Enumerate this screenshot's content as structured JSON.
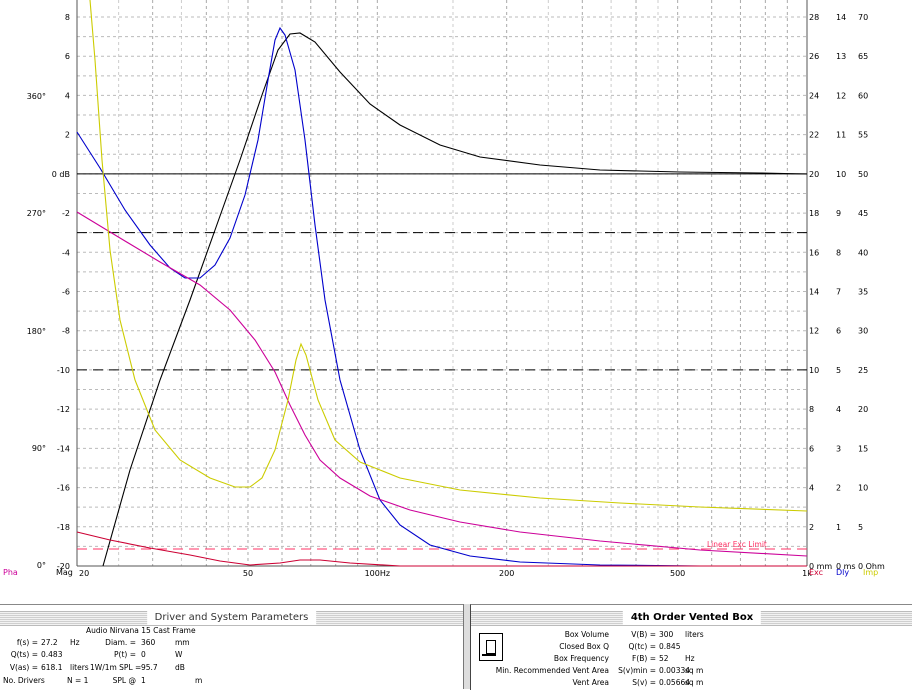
{
  "plot": {
    "left_axis_ticks": [
      "8",
      "6",
      "4",
      "2",
      "0 dB",
      "-2",
      "-4",
      "-6",
      "-8",
      "-10",
      "-12",
      "-14",
      "-16",
      "-18",
      "-20"
    ],
    "phase_labels": [
      "360°",
      "270°",
      "180°",
      "90°",
      "0°"
    ],
    "right_axis1": [
      "28",
      "26",
      "24",
      "22",
      "20",
      "18",
      "16",
      "14",
      "12",
      "10",
      "8",
      "6",
      "4",
      "2",
      "0 mm"
    ],
    "right_axis2": [
      "14",
      "13",
      "12",
      "11",
      "10",
      "9",
      "8",
      "7",
      "6",
      "5",
      "4",
      "3",
      "2",
      "1",
      "0 ms"
    ],
    "right_axis3": [
      "70",
      "65",
      "60",
      "55",
      "50",
      "45",
      "40",
      "35",
      "30",
      "25",
      "20",
      "15",
      "10",
      "5",
      "0 Ohm"
    ],
    "freq_labels": [
      "20",
      "50",
      "100Hz",
      "200",
      "500",
      "1k"
    ],
    "bottom_left_labels": {
      "pha": "Pha",
      "mag": "Mag"
    },
    "bottom_right_labels": {
      "exc": "Exc",
      "dly": "Dly",
      "imp": "Imp"
    },
    "annotation": "Linear Exc Limit",
    "colors": {
      "magnitude": "#000000",
      "excursion": "#0000cc",
      "phase": "#cc0099",
      "delay": "#cc0033",
      "impedance": "#cccc00",
      "limit": "#ff3366",
      "pha_label": "#cc0099",
      "exc_label": "#cc0033",
      "dly_label": "#0000cc",
      "imp_label": "#cccc00"
    }
  },
  "left_panel": {
    "title": "Driver and System Parameters",
    "driver_name": "Audio Nirvana 15 Cast Frame",
    "fs_label": "f(s) =",
    "fs_value": "27.2",
    "fs_unit": "Hz",
    "qts_label": "Q(ts) =",
    "qts_value": "0.483",
    "vas_label": "V(as) =",
    "vas_value": "618.1",
    "vas_unit": "liters",
    "drivers_label": "No. Drivers",
    "drivers_value": "N = 1",
    "diam_label": "Diam. =",
    "diam_value": "360",
    "diam_unit": "mm",
    "pt_label": "P(t) =",
    "pt_value": "0",
    "pt_unit": "W",
    "spl_label": "1W/1m SPL =",
    "spl_value": "95.7",
    "spl_unit": "dB",
    "splat_label": "SPL @",
    "splat_value": "1",
    "splat_unit": "m"
  },
  "right_panel": {
    "title": "4th Order Vented Box",
    "rows": [
      {
        "label": "Box Volume",
        "sym": "V(B) =",
        "value": "300",
        "unit": "liters"
      },
      {
        "label": "Closed Box Q",
        "sym": "Q(tc) =",
        "value": "0.845",
        "unit": ""
      },
      {
        "label": "Box Frequency",
        "sym": "F(B) =",
        "value": "52",
        "unit": "Hz"
      },
      {
        "label": "Min. Recommended Vent Area",
        "sym": "S(v)min =",
        "value": "0.00334",
        "unit": "sq m"
      },
      {
        "label": "Vent Area",
        "sym": "S(v) =",
        "value": "0.05664",
        "unit": "sq m"
      }
    ]
  }
}
